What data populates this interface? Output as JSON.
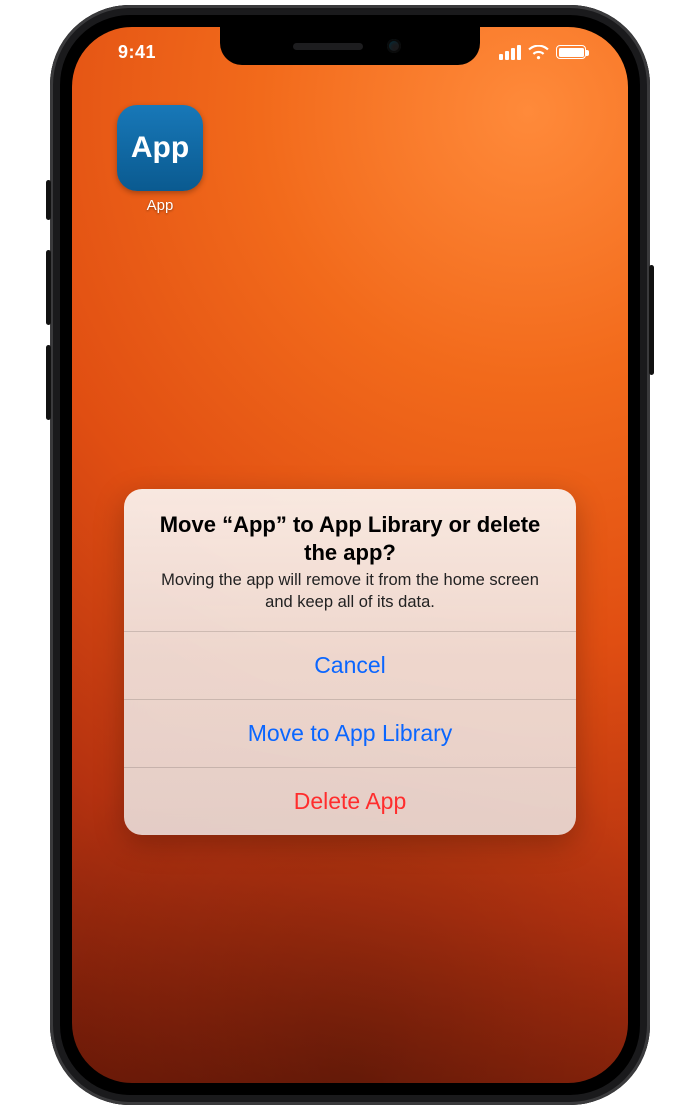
{
  "status_bar": {
    "time": "9:41"
  },
  "home": {
    "app": {
      "icon_text": "App",
      "label": "App"
    }
  },
  "action_sheet": {
    "title": "Move “App” to App Library or delete the app?",
    "description": "Moving the app will remove it from the home screen and keep all of its data.",
    "buttons": {
      "cancel": "Cancel",
      "move": "Move to App Library",
      "delete": "Delete App"
    }
  },
  "colors": {
    "accent_blue": "#0a66ff",
    "destructive_red": "#ff2d2d",
    "app_icon_gradient_top": "#1878b8",
    "app_icon_gradient_bottom": "#0a5a90"
  }
}
